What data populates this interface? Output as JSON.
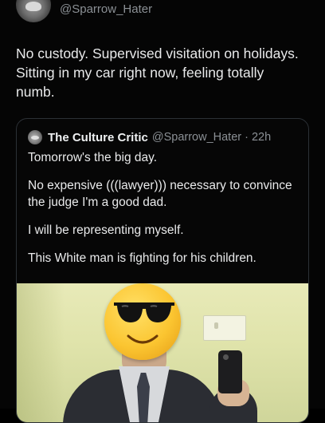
{
  "post": {
    "handle": "@Sparrow_Hater",
    "text": "No custody. Supervised visitation on holidays.\nSitting in my car right now, feeling totally\nnumb."
  },
  "quoted_post": {
    "display_name": "The Culture Critic",
    "handle": "@Sparrow_Hater",
    "separator": "·",
    "time": "22h",
    "paragraphs": [
      "Tomorrow's the big day.",
      "No expensive (((lawyer))) necessary to convince the judge I'm a good dad.",
      "I will be representing myself.",
      "This White man is fighting for his children."
    ]
  },
  "icons": {
    "avatar": "bird-avatar-icon",
    "quote_avatar": "bird-avatar-icon",
    "emoji": "sunglasses-emoji-icon"
  },
  "colors": {
    "background": "#050505",
    "text": "#e9eaeb",
    "muted": "#8b9095",
    "border": "#2c3136"
  }
}
